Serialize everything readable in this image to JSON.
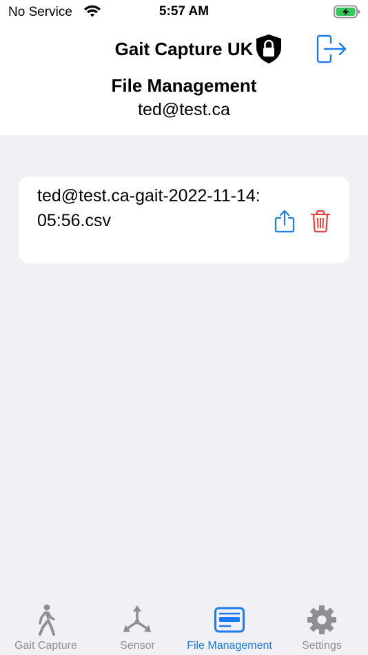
{
  "status_bar": {
    "carrier": "No Service",
    "time": "5:57 AM",
    "wifi_icon": "wifi-icon",
    "battery_icon": "battery-charging-icon"
  },
  "header": {
    "app_title": "Gait Capture UK",
    "page_title": "File Management",
    "user_email": "ted@test.ca",
    "lock_icon": "lock-shield-icon",
    "logout_icon": "logout-icon"
  },
  "files": [
    {
      "name": "ted@test.ca-gait-2022-11-14:05:56.csv",
      "share_icon": "share-icon",
      "delete_icon": "trash-icon"
    }
  ],
  "tab_bar": {
    "tabs": [
      {
        "label": "Gait Capture",
        "icon": "walking-figure-icon",
        "active": false
      },
      {
        "label": "Sensor",
        "icon": "axes-icon",
        "active": false
      },
      {
        "label": "File Management",
        "icon": "file-list-icon",
        "active": true
      },
      {
        "label": "Settings",
        "icon": "gear-icon",
        "active": false
      }
    ]
  },
  "colors": {
    "accent": "#1a7bf2",
    "destructive": "#e8403a",
    "inactive": "#8e8e93",
    "background": "#f0f0f5",
    "card": "#ffffff",
    "battery": "#34c759"
  }
}
